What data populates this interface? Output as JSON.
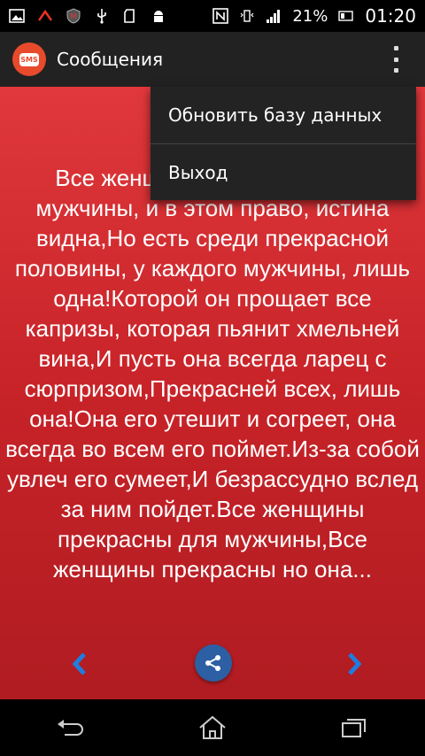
{
  "status_bar": {
    "battery": "21%",
    "time": "01:20"
  },
  "action_bar": {
    "app_icon_label": "SMS",
    "title": "Сообщения"
  },
  "message": {
    "text": "Все женщины прекрасны для мужчины, и в этом право, истина видна,Но есть среди прекрасной половины, у каждого мужчины, лишь одна!Которой он прощает все капризы, которая пьянит хмельней вина,И пусть она всегда ларец с сюрпризом,Прекрасней всех, лишь она!Она его утешит и согреет, она всегда во всем его поймет.Из-за собой увлеч его сумеет,И безрассудно вслед за ним пойдет.Все женщины прекрасны для мужчины,Все женщины прекрасны но она..."
  },
  "menu": {
    "items": [
      {
        "label": "Обновить базу данных"
      },
      {
        "label": "Выход"
      }
    ]
  },
  "colors": {
    "accent_blue": "#1f7de0",
    "share_blue": "#2c5fa3",
    "background_red": "#c72328"
  }
}
